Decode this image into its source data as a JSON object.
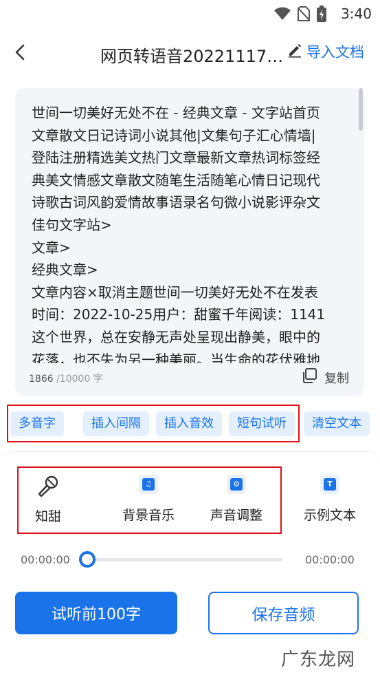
{
  "status_bar": {
    "time": "3:40",
    "icons": [
      "wifi-icon",
      "no-sim-icon",
      "battery-charging-icon"
    ]
  },
  "header": {
    "title": "网页转语音202211171…",
    "import_label": "导入文档"
  },
  "editor": {
    "text": "世间一切美好无处不在 - 经典文章 - 文字站首页\n文章散文日记诗词小说其他|文集句子汇心情墙|\n登陆注册精选美文热门文章最新文章热词标签经\n典美文情感文章散文随笔生活随笔心情日记现代\n诗歌古词风韵爱情故事语录名句微小说影评杂文\n佳句文字站>\n文章>\n经典文章>\n文章内容×取消主题世间一切美好无处不在发表\n时间：2022-10-25用户：甜蜜千年阅读：1141\n这个世界，总在安静无声处呈现出静美，眼中的\n花落，也不失为另一种美丽。当生命的花伏雅地",
    "char_count": "1866",
    "char_max": "/10000 字",
    "copy_label": "复制"
  },
  "chips": [
    {
      "label": "多音字"
    },
    {
      "label": "插入间隔"
    },
    {
      "label": "插入音效"
    },
    {
      "label": "短句试听"
    },
    {
      "label": "清空文本"
    }
  ],
  "tools": [
    {
      "label": "知甜",
      "icon": "microphone-icon"
    },
    {
      "label": "背景音乐",
      "icon": "music-note-icon",
      "glyph": "♫"
    },
    {
      "label": "声音调整",
      "icon": "settings-gear-icon",
      "glyph": "⚙"
    },
    {
      "label": "示例文本",
      "icon": "text-t-icon",
      "glyph": "T"
    }
  ],
  "player": {
    "current": "00:00:00",
    "total": "00:00:00",
    "progress": 0
  },
  "actions": {
    "preview_label": "试听前100字",
    "save_label": "保存音频"
  },
  "watermark": "广东龙网",
  "colors": {
    "accent": "#1a73e8",
    "chip_bg": "#e3effd",
    "highlight_border": "#e0101a",
    "card_bg": "#f3f5f8"
  }
}
